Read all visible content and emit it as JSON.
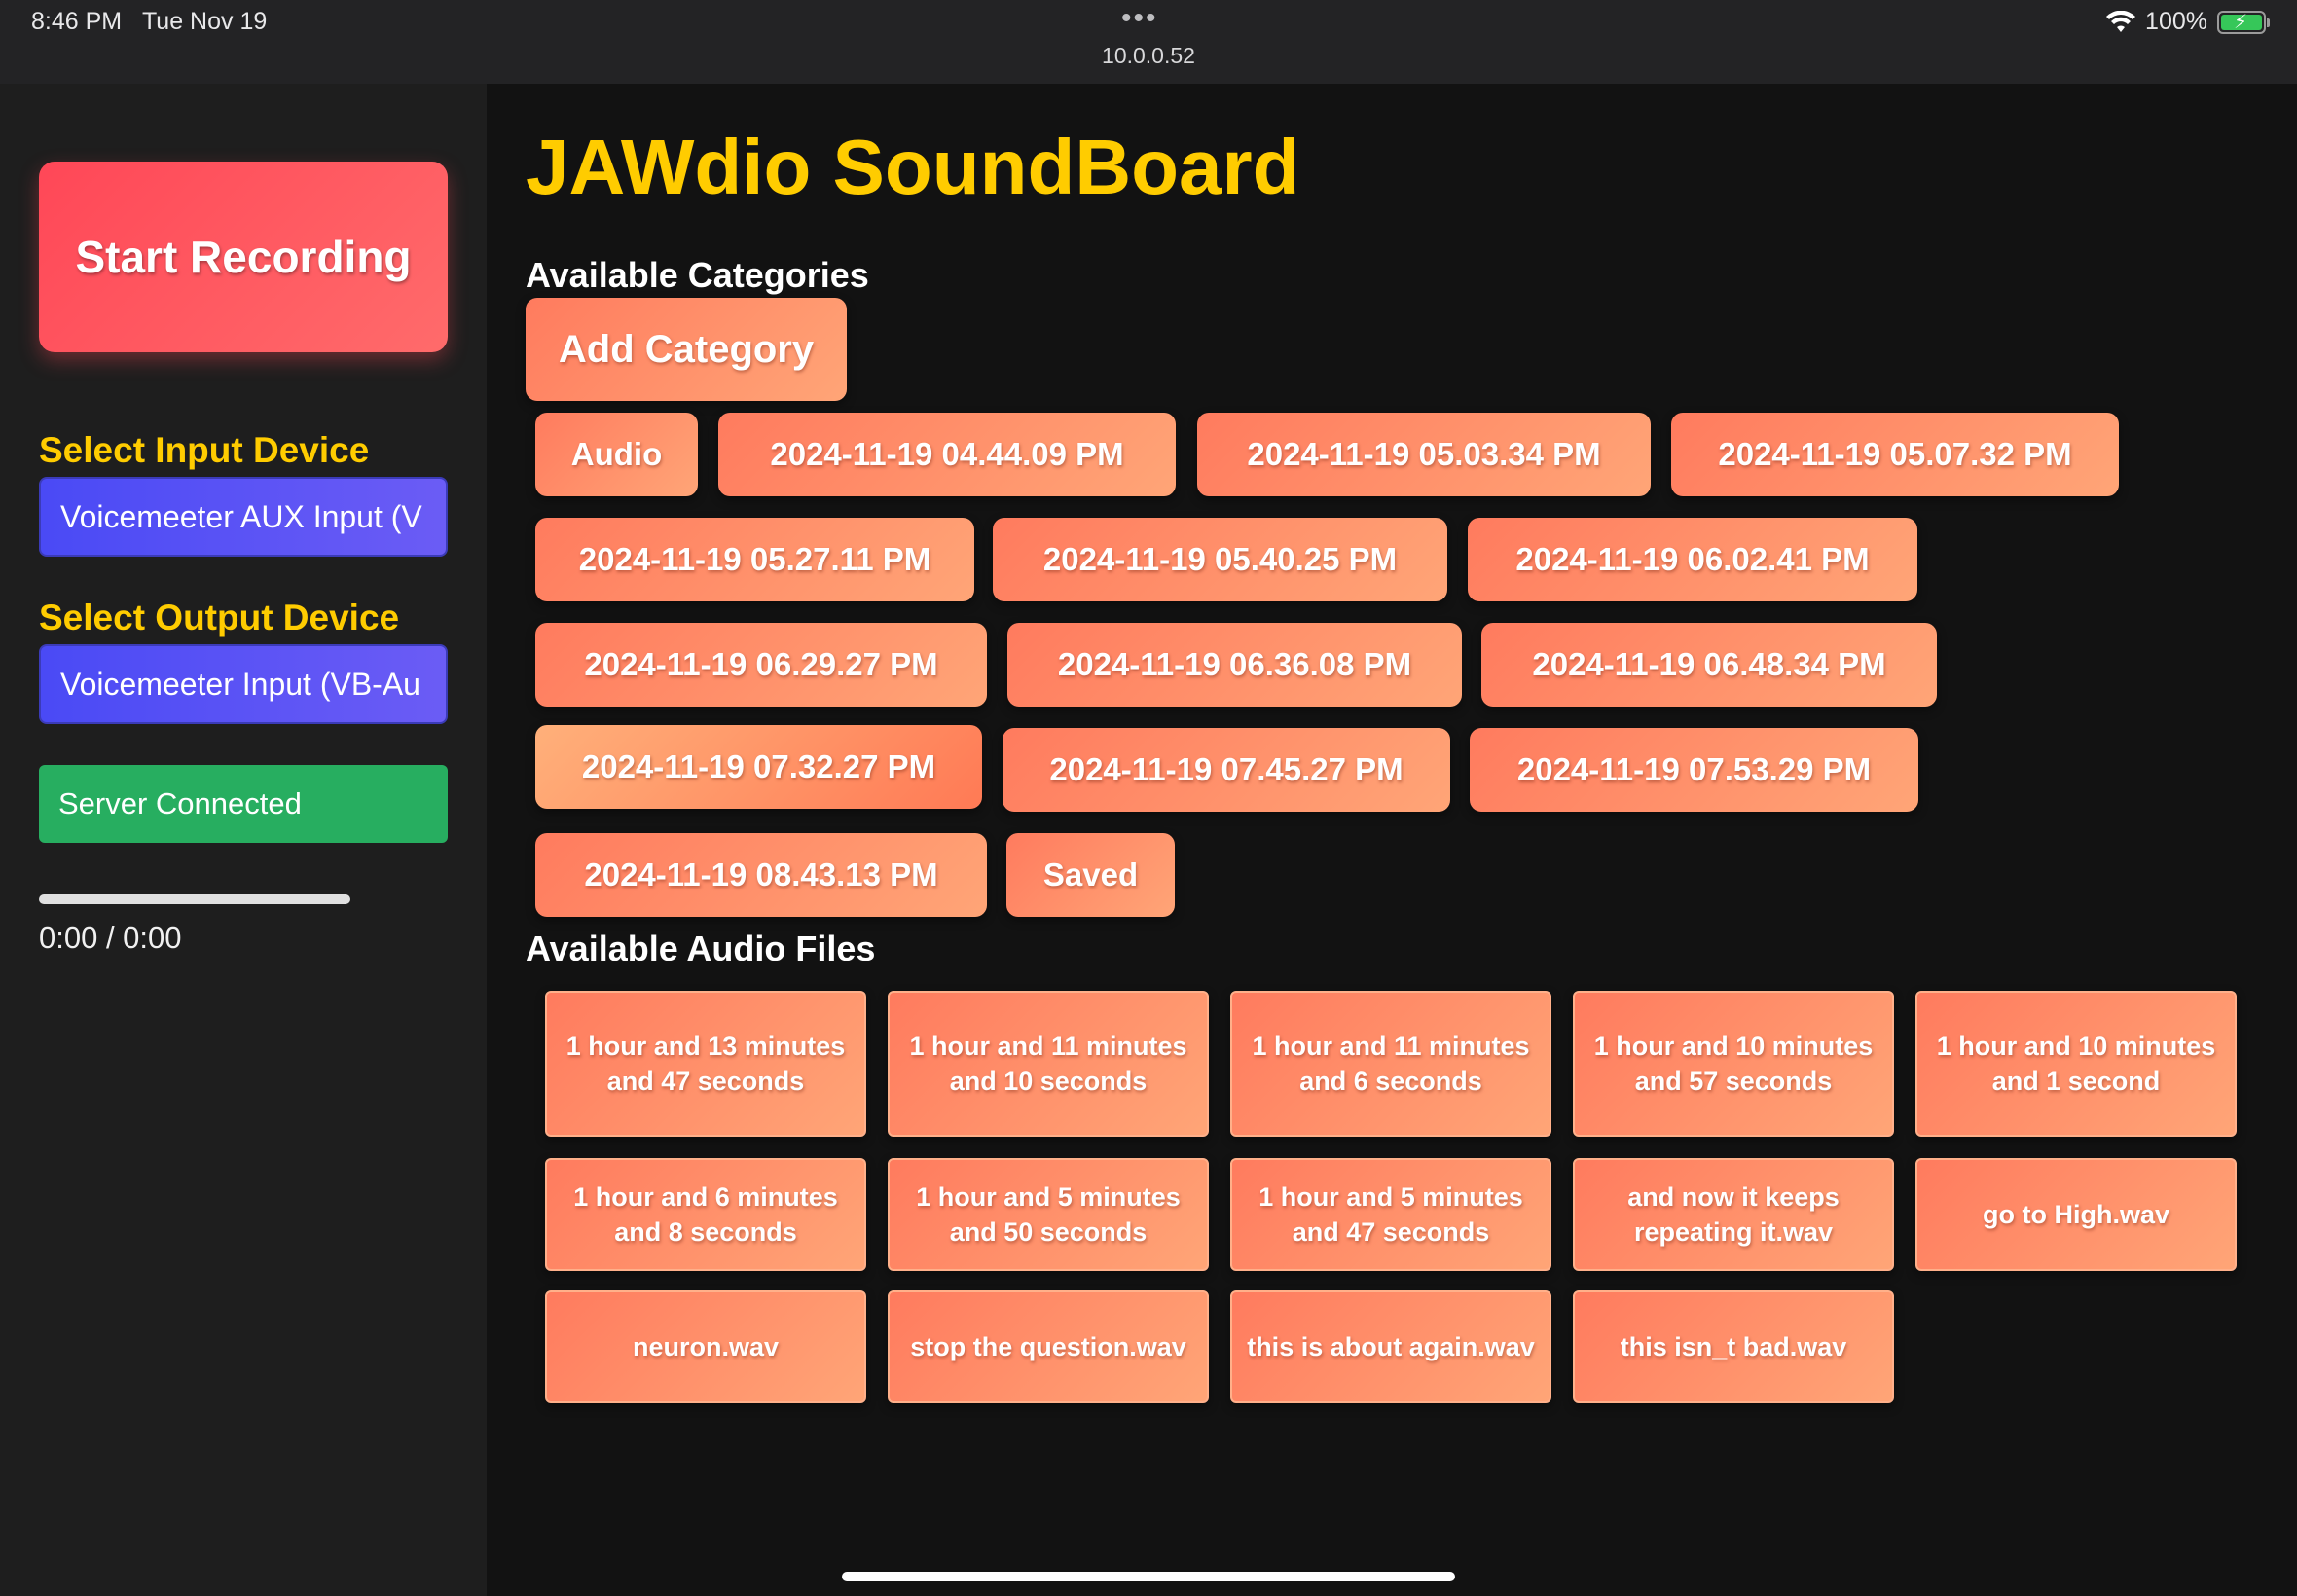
{
  "status_bar": {
    "time": "8:46 PM",
    "date": "Tue Nov 19",
    "url": "10.0.0.52",
    "battery": "100%"
  },
  "sidebar": {
    "record_button": "Start Recording",
    "input_label": "Select Input Device",
    "input_value": "Voicemeeter AUX Input (V",
    "output_label": "Select Output Device",
    "output_value": "Voicemeeter Input (VB-Au",
    "server_status": "Server Connected",
    "progress": 0,
    "time_display": "0:00 / 0:00"
  },
  "main": {
    "title": "JAWdio SoundBoard",
    "categories_heading": "Available Categories",
    "add_category": "Add Category",
    "categories": [
      "Audio",
      "2024-11-19 04.44.09 PM",
      "2024-11-19 05.03.34 PM",
      "2024-11-19 05.07.32 PM",
      "2024-11-19 05.27.11 PM",
      "2024-11-19 05.40.25 PM",
      "2024-11-19 06.02.41 PM",
      "2024-11-19 06.29.27 PM",
      "2024-11-19 06.36.08 PM",
      "2024-11-19 06.48.34 PM",
      "2024-11-19 07.32.27 PM",
      "2024-11-19 07.45.27 PM",
      "2024-11-19 07.53.29 PM",
      "2024-11-19 08.43.13 PM",
      "Saved"
    ],
    "active_category": "2024-11-19 07.32.27 PM",
    "audio_heading": "Available Audio Files",
    "audio_files": [
      "1 hour and 13 minutes and 47 seconds",
      "1 hour and 11 minutes and 10 seconds",
      "1 hour and 11 minutes and 6 seconds",
      "1 hour and 10 minutes and 57 seconds",
      "1 hour and 10 minutes and 1 second",
      "1 hour and 6 minutes and 8 seconds",
      "1 hour and 5 minutes and 50 seconds",
      "1 hour and 5 minutes and 47 seconds",
      "and now it keeps repeating it.wav",
      "go to High.wav",
      "neuron.wav",
      "stop the question.wav",
      "this is about again.wav",
      "this isn_t bad.wav"
    ]
  },
  "colors": {
    "accent_yellow": "#ffcc00",
    "record_red": "#ff4757",
    "select_blue": "#4a4af5",
    "server_green": "#27ae60",
    "button_orange": "#ff8c66"
  }
}
